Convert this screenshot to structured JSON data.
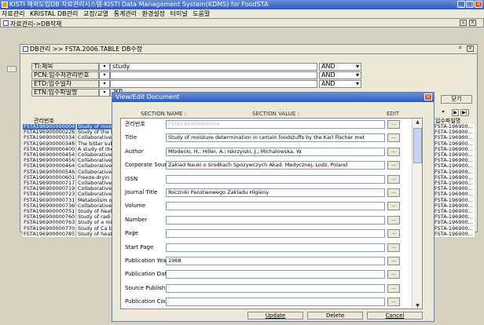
{
  "app": {
    "title": "KISTI 해외도입DB 자료관리시스템-KISTI Data Management System(KDMS) for FoodSTA"
  },
  "menu": [
    "자료관리",
    "KRISTAL DB관리",
    "교정/교열",
    "통계관리",
    "환경설정",
    "터미널",
    "도움말"
  ],
  "child1": {
    "title": "자료관리->DB작재"
  },
  "child2": {
    "title": "DB관리 >> FSTA.2006.TABLE DB수정"
  },
  "search_rows": [
    {
      "label": "TI:제목",
      "value": "study",
      "op": "AND"
    },
    {
      "label": "PCN:입수처관리번호",
      "value": "",
      "op": "AND"
    },
    {
      "label": "ETD:입수일자",
      "value": "",
      "op": "AND"
    },
    {
      "label": "ETN:입수파일명",
      "value": "",
      "op": ""
    }
  ],
  "partial_label": "경재",
  "close_button": "닫기",
  "table": {
    "col_header": "관리번호",
    "right_header": "입수파일명",
    "rows": [
      {
        "id": "FSTA196900000004",
        "title": "Study of mois",
        "right": "FSTA-196900..."
      },
      {
        "id": "FSTA196900000226",
        "title": "Study of the f",
        "right": "FSTA-196900..."
      },
      {
        "id": "FSTA196900000334",
        "title": "Collaborative",
        "right": "FSTA-196900..."
      },
      {
        "id": "FSTA196900000348",
        "title": "The bitter sub",
        "right": "FSTA-196900..."
      },
      {
        "id": "FSTA196900000400",
        "title": "A study of the",
        "right": "FSTA-196900..."
      },
      {
        "id": "FSTA196900000454",
        "title": "Collaborative",
        "right": "FSTA-196900..."
      },
      {
        "id": "FSTA196900000456",
        "title": "Collaborative",
        "right": "FSTA-196900..."
      },
      {
        "id": "FSTA196900000464",
        "title": "Collaborative",
        "right": "FSTA-196900..."
      },
      {
        "id": "FSTA196900000546",
        "title": "Collaborative",
        "right": "FSTA-196900..."
      },
      {
        "id": "FSTA196900000601",
        "title": "Freeze-dryin",
        "right": "FSTA-196900..."
      },
      {
        "id": "FSTA196900000717",
        "title": "Collaborative",
        "right": "FSTA-196900..."
      },
      {
        "id": "FSTA196900000719",
        "title": "Collaborative",
        "right": "FSTA-196900..."
      },
      {
        "id": "FSTA196900000723",
        "title": "Collaborative",
        "right": "FSTA-196900..."
      },
      {
        "id": "FSTA196900000731",
        "title": "Metabolism o",
        "right": "FSTA-196900..."
      },
      {
        "id": "FSTA196900000736",
        "title": "Collaborative",
        "right": "FSTA-196900..."
      },
      {
        "id": "FSTA196900000751",
        "title": "Study of heat",
        "right": "FSTA-196900..."
      },
      {
        "id": "FSTA196900000760",
        "title": "Study of radi",
        "right": "FSTA-196900..."
      },
      {
        "id": "FSTA196900000763",
        "title": "Study of a mi",
        "right": "FSTA-196900..."
      },
      {
        "id": "FSTA196900000770",
        "title": "Study of Ca b",
        "right": "FSTA-196900..."
      },
      {
        "id": "FSTA196900000785",
        "title": "Study of heat",
        "right": "FSTA-196900..."
      }
    ]
  },
  "dialog": {
    "title": "View/Edit Document",
    "head_name": "SECTION NAME :",
    "head_value": "SECTION VALUE :",
    "head_edit": "EDIT",
    "btn_dots": "...",
    "fields": [
      {
        "name": "관리번호",
        "value": "FSTA196900000004",
        "disabled": true
      },
      {
        "name": "Title",
        "value": "Study of moisture determination in certain foodstuffs by the Karl Fischer met"
      },
      {
        "name": "Author",
        "value": "Mlodecki, H.; Hiller, A.; Iskrzyiski, J.; Michalowska, W."
      },
      {
        "name": "Corporate Source.",
        "value": "Zaklad Nauki o Srodkach Spozywczych Akad. Medycznej, Lodz, Poland"
      },
      {
        "name": "ISSN",
        "value": ""
      },
      {
        "name": "Journal Title",
        "value": "Roczniki Panstwowego Zakladu Higieny"
      },
      {
        "name": "Volume",
        "value": ""
      },
      {
        "name": "Number",
        "value": ""
      },
      {
        "name": "Page",
        "value": ""
      },
      {
        "name": "Start Page",
        "value": ""
      },
      {
        "name": "Publication Year",
        "value": "1968"
      },
      {
        "name": "Publication Date",
        "value": ""
      },
      {
        "name": "Source Publish Date",
        "value": ""
      },
      {
        "name": "Publication Country",
        "value": ""
      }
    ],
    "buttons": {
      "update": "Update",
      "delete": "Delete",
      "cancel": "Cancel"
    }
  }
}
